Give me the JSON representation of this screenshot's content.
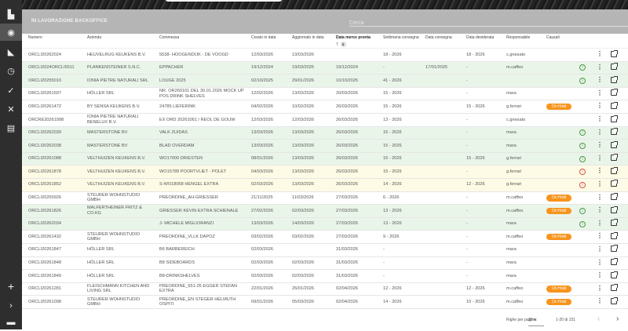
{
  "header": {
    "title": "IN LAVORAZIONE BACKOFFICE",
    "search_placeholder": "Cerca"
  },
  "sidebar": {
    "icons": [
      "dashboard-icon",
      "orders-icon",
      "ruler-icon",
      "clock-icon",
      "check-circle-icon",
      "tools-icon",
      "archive-icon",
      "plus-icon",
      "chevron-right-icon",
      "footer-icon"
    ],
    "active": "orders-icon"
  },
  "columns": [
    "Numero",
    "Azienda",
    "Commessa",
    "Creato in data",
    "Aggiornato in data",
    "Data merce pronta",
    "Settimana consegna",
    "Data consegna",
    "Data desiderata",
    "Responsabile",
    "Causali"
  ],
  "sort": {
    "column": "Data merce pronta",
    "direction": "asc",
    "priority": "1"
  },
  "colors": {
    "green_row": "#eaf5ea",
    "yellow_row": "#fdfbe5",
    "on_hold": "#f7941d",
    "info": "#4a9a4a",
    "warning": "#d9534f"
  },
  "rows": [
    {
      "numero": "ORCLI20262024",
      "azienda": "HEUVELRUG KEUKENS B.V.",
      "commessa": "5538- HOOGENDIJK - DE VOOGD",
      "creato": "12/03/2026",
      "aggiornato": "13/03/2026",
      "merce": "",
      "settimana": "18 - 2026",
      "consegna": "",
      "desiderata": "18 - 2026",
      "responsabile": "c.gnesato",
      "causali": "",
      "status": "",
      "row": ""
    },
    {
      "numero": "ORCLI2024ORCLI5511",
      "azienda": "PLANKENSTEINER S.N.C.",
      "commessa": "EPPACHER",
      "creato": "19/12/2024",
      "aggiornato": "19/03/2025",
      "merce": "19/12/2024",
      "settimana": "-",
      "consegna": "17/01/2025",
      "desiderata": "-",
      "responsabile": "m.caffeo",
      "causali": "",
      "status": "info",
      "row": "green"
    },
    {
      "numero": "ORCLI20255010",
      "azienda": "IONIA PIETRE NATURALI SRL",
      "commessa": "LOUGE 2025",
      "creato": "02/10/2025",
      "aggiornato": "29/01/2026",
      "merce": "10/10/2025",
      "settimana": "41 - 2026",
      "consegna": "",
      "desiderata": "-",
      "responsabile": "",
      "causali": "",
      "status": "info",
      "row": "green"
    },
    {
      "numero": "ORCLI20261597",
      "azienda": "HÖLLER SRL",
      "commessa": "NR. OR260101 DEL 30.01.2026 MOCK UP POS DRINK SHELVES",
      "creato": "12/02/2026",
      "aggiornato": "13/03/2026",
      "merce": "20/03/2026",
      "settimana": "15 - 2026",
      "consegna": "",
      "desiderata": "-",
      "responsabile": "mara",
      "causali": "",
      "status": "",
      "row": ""
    },
    {
      "numero": "ORCLI20261472",
      "azienda": "BY SENSA KEUKENS B.V.",
      "commessa": "24785 LIEFERINK",
      "creato": "04/02/2026",
      "aggiornato": "10/02/2026",
      "merce": "26/03/2026",
      "settimana": "15 - 2026",
      "consegna": "",
      "desiderata": "15 - 2026",
      "responsabile": "g.ferrari",
      "causali": "On Hold",
      "status": "",
      "row": ""
    },
    {
      "numero": "ORCRE20261998",
      "azienda": "IONIA PIETRE NATURALI BENELUX B.V.",
      "commessa": "EX ORD 20261061 / REOL DE GOUW",
      "creato": "12/03/2026",
      "aggiornato": "12/03/2026",
      "merce": "26/03/2026",
      "settimana": "13 - 2026",
      "consegna": "",
      "desiderata": "-",
      "responsabile": "c.gnesato",
      "causali": "",
      "status": "",
      "row": ""
    },
    {
      "numero": "ORCLI20262039",
      "azienda": "MASTERSTONE BV",
      "commessa": "VALK ZUIDAS",
      "creato": "13/03/2026",
      "aggiornato": "13/03/2026",
      "merce": "26/03/2026",
      "settimana": "15 - 2026",
      "consegna": "",
      "desiderata": "-",
      "responsabile": "mara",
      "causali": "",
      "status": "info",
      "row": "green"
    },
    {
      "numero": "ORCLI20262038",
      "azienda": "MASTERSTONE BV",
      "commessa": "BLAD OVERDAM",
      "creato": "13/03/2026",
      "aggiornato": "13/03/2026",
      "merce": "26/03/2026",
      "settimana": "15 - 2026",
      "consegna": "",
      "desiderata": "-",
      "responsabile": "mara",
      "causali": "",
      "status": "info",
      "row": "green"
    },
    {
      "numero": "ORCLI20261088",
      "azienda": "VELTHUIZEN KEUKENS B.V.",
      "commessa": "WO17000 DRIESTEN",
      "creato": "08/01/2026",
      "aggiornato": "13/03/2026",
      "merce": "26/03/2026",
      "settimana": "15 - 2026",
      "consegna": "",
      "desiderata": "15 - 2026",
      "responsabile": "g.ferrari",
      "causali": "",
      "status": "info",
      "row": "green"
    },
    {
      "numero": "ORCLI20261878",
      "azienda": "VELTHUIZEN KEUKENS B.V.",
      "commessa": "WO15789 POORTVLIET - POLET",
      "creato": "04/03/2026",
      "aggiornato": "13/03/2026",
      "merce": "26/03/2026",
      "settimana": "15 - 2026",
      "consegna": "",
      "desiderata": "-",
      "responsabile": "g.ferrari",
      "causali": "",
      "status": "warn",
      "row": "yellow"
    },
    {
      "numero": "ORCLI20261852",
      "azienda": "VELTHUIZEN KEUKENS B.V.",
      "commessa": "S-WO18058 HENGEL EXTRA",
      "creato": "02/03/2026",
      "aggiornato": "13/03/2026",
      "merce": "26/03/2026",
      "settimana": "14 - 2026",
      "consegna": "",
      "desiderata": "12 - 2026",
      "responsabile": "g.ferrari",
      "causali": "",
      "status": "warn",
      "row": "yellow"
    },
    {
      "numero": "ORCLI20255926",
      "azienda": "STEURER WOHNSTUDIO GMBH",
      "commessa": "PREORDINE_AH-GRIESSER",
      "creato": "21/11/2025",
      "aggiornato": "11/03/2026",
      "merce": "27/03/2026",
      "settimana": "6 - 2026",
      "consegna": "",
      "desiderata": "-",
      "responsabile": "m.caffeo",
      "causali": "On Hold",
      "status": "",
      "row": ""
    },
    {
      "numero": "ORCLI20261826",
      "azienda": "MALFERTHEINER FRITZ & CO.KG",
      "commessa": "GRIESSER KEVIN EXTRA SCHIENALE",
      "creato": "27/02/2026",
      "aggiornato": "02/03/2026",
      "merce": "27/03/2026",
      "settimana": "13 - 2026",
      "consegna": "",
      "desiderata": "-",
      "responsabile": "m.caffeo",
      "causali": "On Hold",
      "status": "info",
      "row": "green"
    },
    {
      "numero": "ORCLI20262034",
      "azienda": "",
      "commessa": "J- MICHELE MIGLIORANZI",
      "creato": "13/03/2026",
      "aggiornato": "14/03/2026",
      "merce": "27/03/2026",
      "settimana": "13 - 2026",
      "consegna": "",
      "desiderata": "-",
      "responsabile": "mara",
      "causali": "",
      "status": "info",
      "row": "green"
    },
    {
      "numero": "ORCLI20261432",
      "azienda": "STEURER WOHNSTUDIO GMBH",
      "commessa": "PREORDINE_VLLK DAPOZ",
      "creato": "03/02/2026",
      "aggiornato": "03/02/2026",
      "merce": "27/03/2026",
      "settimana": "9 - 2026",
      "consegna": "",
      "desiderata": "-",
      "responsabile": "m.caffeo",
      "causali": "On Hold",
      "status": "",
      "row": ""
    },
    {
      "numero": "ORCLI20261847",
      "azienda": "HÖLLER SRL",
      "commessa": "B6 BARBEREICH",
      "creato": "02/03/2026",
      "aggiornato": "",
      "merce": "31/03/2026",
      "settimana": "-",
      "consegna": "",
      "desiderata": "-",
      "responsabile": "mara",
      "causali": "",
      "status": "",
      "row": ""
    },
    {
      "numero": "ORCLI20261848",
      "azienda": "HÖLLER SRL",
      "commessa": "B8 SIDEBOARDS",
      "creato": "02/03/2026",
      "aggiornato": "02/03/2026",
      "merce": "31/03/2026",
      "settimana": "-",
      "consegna": "",
      "desiderata": "-",
      "responsabile": "mara",
      "causali": "",
      "status": "",
      "row": ""
    },
    {
      "numero": "ORCLI20261849",
      "azienda": "HÖLLER SRL",
      "commessa": "B8-DRINKSHELVES",
      "creato": "02/03/2026",
      "aggiornato": "02/03/2026",
      "merce": "31/03/2026",
      "settimana": "-",
      "consegna": "",
      "desiderata": "-",
      "responsabile": "mara",
      "causali": "",
      "status": "",
      "row": ""
    },
    {
      "numero": "ORCLI20261281",
      "azienda": "FLEISCHMANN KITCHEN AND LIVING SRL",
      "commessa": "PREORDINE_651-25 EGGER STEFAN EXTRA",
      "creato": "22/01/2026",
      "aggiornato": "26/01/2026",
      "merce": "02/04/2026",
      "settimana": "12 - 2026",
      "consegna": "",
      "desiderata": "12 - 2026",
      "responsabile": "m.caffeo",
      "causali": "On Hold",
      "status": "",
      "row": ""
    },
    {
      "numero": "ORCLI20261098",
      "azienda": "STEURER WOHNSTUDIO GMBH",
      "commessa": "PREORDINE_EN STEGER HELMUTH OSPITI",
      "creato": "09/01/2026",
      "aggiornato": "05/03/2026",
      "merce": "02/04/2026",
      "settimana": "14 - 2026",
      "consegna": "",
      "desiderata": "10 - 2026",
      "responsabile": "m.caffeo",
      "causali": "On Hold",
      "status": "",
      "row": ""
    }
  ],
  "pagination": {
    "rows_per_page_label": "Righe per pagina:",
    "rows_per_page": "20",
    "range": "1-20 di 151",
    "prev": "‹",
    "next": "›"
  }
}
